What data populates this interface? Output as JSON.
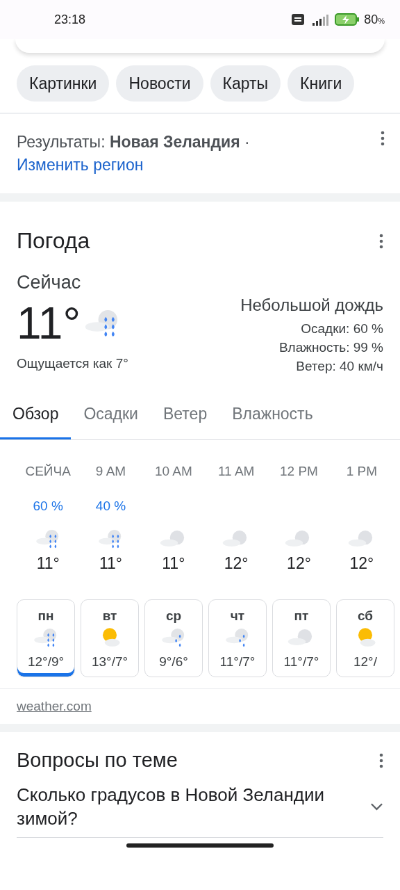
{
  "status_bar": {
    "time": "23:18",
    "battery": "80",
    "battery_unit": "%"
  },
  "chips": [
    {
      "label": "Картинки"
    },
    {
      "label": "Новости"
    },
    {
      "label": "Карты"
    },
    {
      "label": "Книги"
    }
  ],
  "region": {
    "prefix": "Результаты: **Новая Зеландия** ·",
    "link": "Изменить регион"
  },
  "weather": {
    "title": "Погода",
    "now_label": "Сейчас",
    "temperature": "11°",
    "kind": "rain",
    "feels_like": "Ощущается как 7°",
    "condition": "Небольшой дождь",
    "details": [
      "Осадки: 60 %",
      "Влажность: 99 %",
      "Ветер: 40 км/ч"
    ],
    "tabs": [
      {
        "label": "Обзор",
        "selected": true
      },
      {
        "label": "Осадки",
        "selected": false
      },
      {
        "label": "Ветер",
        "selected": false
      },
      {
        "label": "Влажность",
        "selected": false
      }
    ],
    "hours": [
      {
        "time": "СЕЙЧА",
        "precip": "60 %",
        "kind": "rain",
        "temp": "11°"
      },
      {
        "time": "9 AM",
        "precip": "40 %",
        "kind": "rain",
        "temp": "11°"
      },
      {
        "time": "10 AM",
        "kind": "cloudy",
        "temp": "11°"
      },
      {
        "time": "11 AM",
        "kind": "cloudy",
        "temp": "12°"
      },
      {
        "time": "12 PM",
        "kind": "cloudy",
        "temp": "12°"
      },
      {
        "time": "1 PM",
        "kind": "cloudy",
        "temp": "12°"
      }
    ],
    "days": [
      {
        "day": "пн",
        "kind": "rain",
        "temps": "12°/9°",
        "selected": true
      },
      {
        "day": "вт",
        "kind": "sunny",
        "temps": "13°/7°",
        "selected": false
      },
      {
        "day": "ср",
        "kind": "showers",
        "temps": "9°/6°",
        "selected": false
      },
      {
        "day": "чт",
        "kind": "showers",
        "temps": "11°/7°",
        "selected": false
      },
      {
        "day": "пт",
        "kind": "cloudy",
        "temps": "11°/7°",
        "selected": false
      },
      {
        "day": "сб",
        "kind": "sunny",
        "temps": "12°/",
        "selected": false
      }
    ],
    "source": "weather.com"
  },
  "questions": {
    "title": "Вопросы по теме",
    "items": [
      {
        "text": "Сколько градусов в Новой Зеландии зимой?",
        "expanded": false
      }
    ]
  }
}
